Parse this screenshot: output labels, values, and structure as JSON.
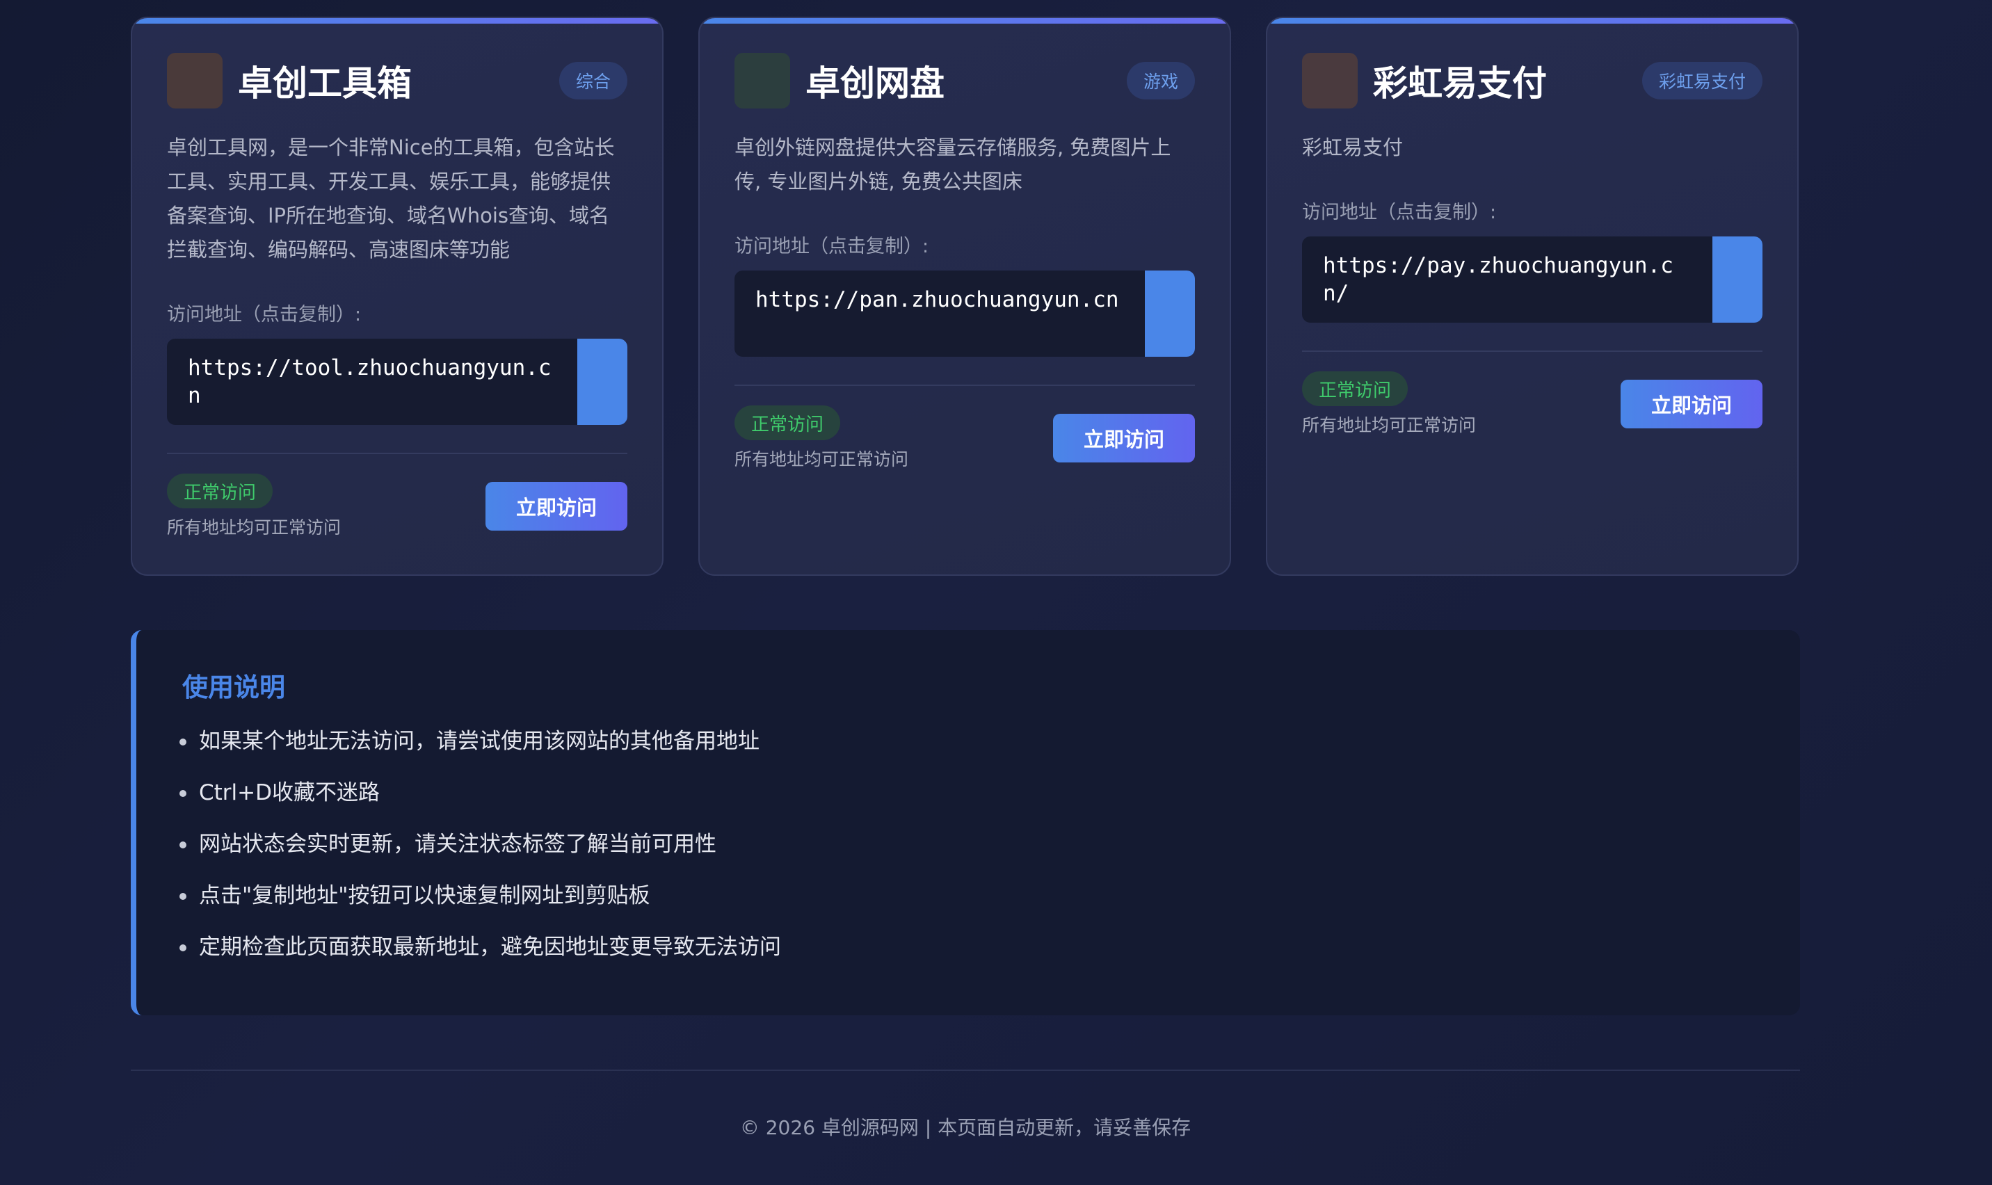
{
  "cards": [
    {
      "title": "卓创工具箱",
      "tag": "综合",
      "logo_color": "#4a3a3a",
      "description": "卓创工具网，是一个非常Nice的工具箱，包含站长工具、实用工具、开发工具、娱乐工具，能够提供备案查询、IP所在地查询、域名Whois查询、域名拦截查询、编码解码、高速图床等功能",
      "address_label": "访问地址（点击复制）:",
      "address": "https://tool.zhuochuangyun.cn",
      "status": "正常访问",
      "status_note": "所有地址均可正常访问",
      "visit_label": "立即访问"
    },
    {
      "title": "卓创网盘",
      "tag": "游戏",
      "logo_color": "#2c3e3e",
      "description": "卓创外链网盘提供大容量云存储服务, 免费图片上传, 专业图片外链, 免费公共图床",
      "address_label": "访问地址（点击复制）:",
      "address": "https://pan.zhuochuangyun.cn",
      "status": "正常访问",
      "status_note": "所有地址均可正常访问",
      "visit_label": "立即访问"
    },
    {
      "title": "彩虹易支付",
      "tag": "彩虹易支付",
      "logo_color": "#4a3a3e",
      "description": "彩虹易支付",
      "address_label": "访问地址（点击复制）:",
      "address": "https://pay.zhuochuangyun.cn/",
      "status": "正常访问",
      "status_note": "所有地址均可正常访问",
      "visit_label": "立即访问"
    }
  ],
  "notes": {
    "title": "使用说明",
    "items": [
      "如果某个地址无法访问，请尝试使用该网站的其他备用地址",
      "Ctrl+D收藏不迷路",
      "网站状态会实时更新，请关注状态标签了解当前可用性",
      "点击\"复制地址\"按钮可以快速复制网址到剪贴板",
      "定期检查此页面获取最新地址，避免因地址变更导致无法访问"
    ]
  },
  "footer": {
    "text": "© 2026 卓创源码网 | 本页面自动更新，请妥善保存"
  }
}
